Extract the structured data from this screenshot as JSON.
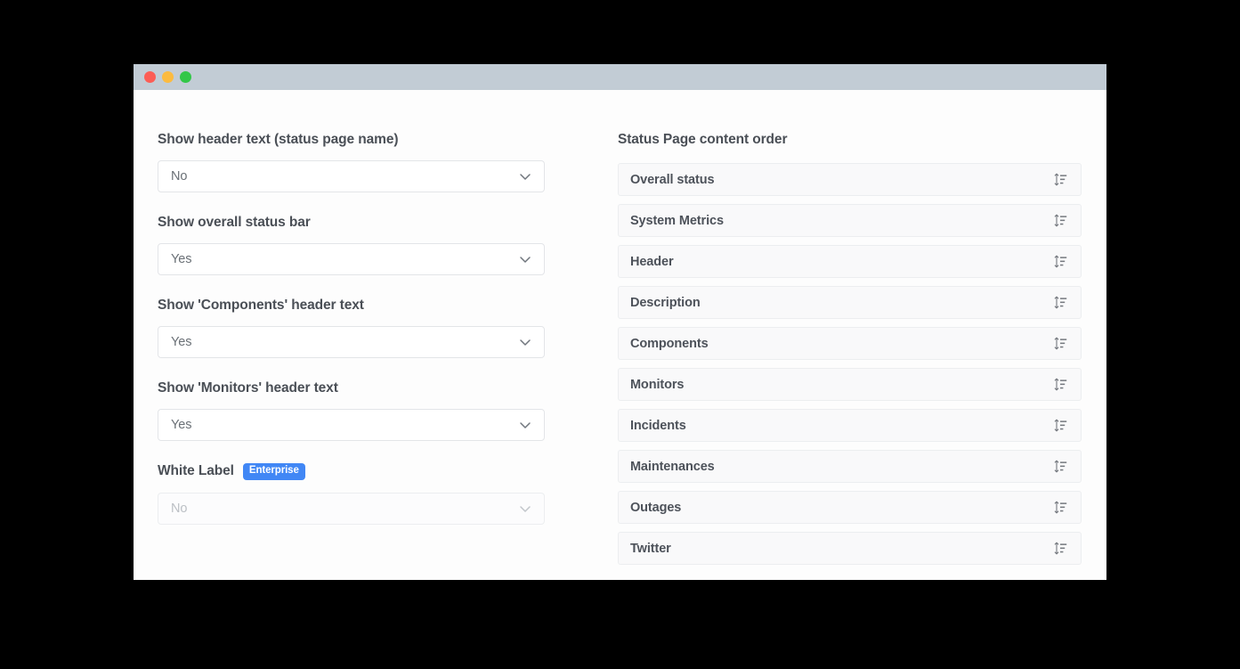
{
  "window": {
    "traffic_lights": [
      {
        "name": "close",
        "color": "#fc5d55"
      },
      {
        "name": "minimize",
        "color": "#fcbb40"
      },
      {
        "name": "maximize",
        "color": "#33c748"
      }
    ]
  },
  "theme": {
    "titlebar_bg": "#c2ccd5",
    "page_bg": "#fdfdfd",
    "badge_blue": "#4187f5",
    "row_bg": "#f9f9fa",
    "border": "#eceef0",
    "label_text": "#4a4f56",
    "value_text": "#6a7076",
    "disabled_text": "#bcc0c5"
  },
  "left_column": {
    "fields": [
      {
        "label": "Show header text (status page name)",
        "value": "No",
        "disabled": false,
        "badge": null
      },
      {
        "label": "Show overall status bar",
        "value": "Yes",
        "disabled": false,
        "badge": null
      },
      {
        "label": "Show 'Components' header text",
        "value": "Yes",
        "disabled": false,
        "badge": null
      },
      {
        "label": "Show 'Monitors' header text",
        "value": "Yes",
        "disabled": false,
        "badge": null
      },
      {
        "label": "White Label",
        "value": "No",
        "disabled": true,
        "badge": "Enterprise"
      }
    ],
    "dropdown_options": [
      "Yes",
      "No"
    ],
    "chevron_icon": "chevron-down-icon"
  },
  "right_column": {
    "title": "Status Page content order",
    "reorder_icon": "sort-reorder-icon",
    "items": [
      {
        "label": "Overall status"
      },
      {
        "label": "System Metrics"
      },
      {
        "label": "Header"
      },
      {
        "label": "Description"
      },
      {
        "label": "Components"
      },
      {
        "label": "Monitors"
      },
      {
        "label": "Incidents"
      },
      {
        "label": "Maintenances"
      },
      {
        "label": "Outages"
      },
      {
        "label": "Twitter"
      }
    ]
  }
}
